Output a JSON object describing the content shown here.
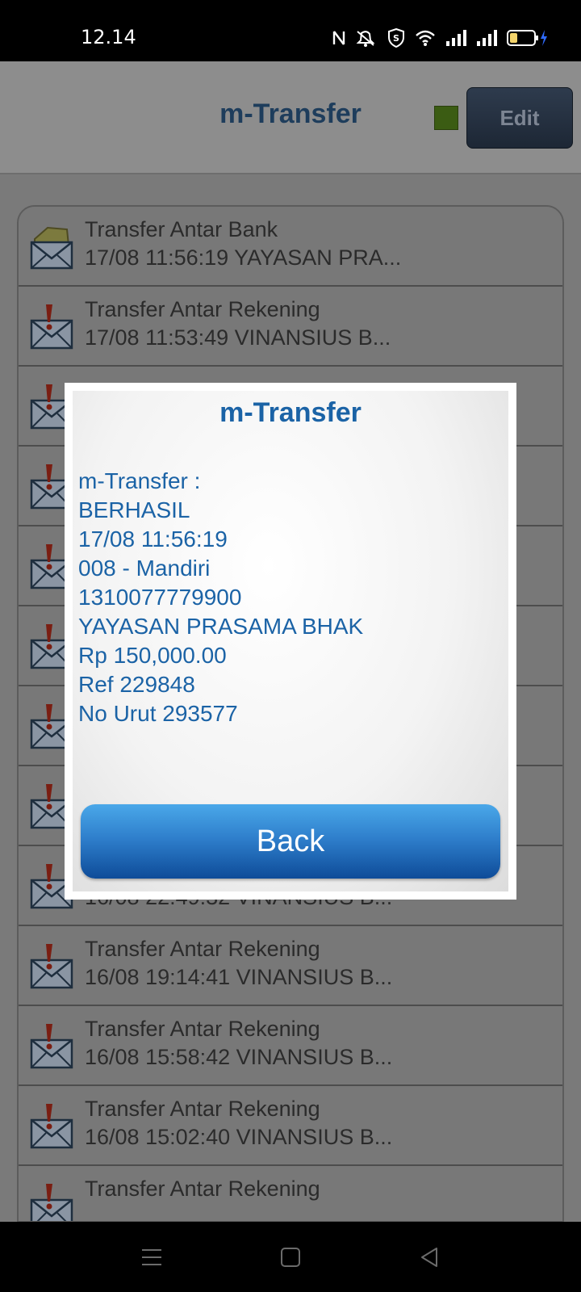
{
  "status_bar": {
    "time": "12.14",
    "icons": [
      "nfc-icon",
      "mute-icon",
      "shield-icon",
      "wifi-icon",
      "signal-icon",
      "signal-icon",
      "battery-charging-icon"
    ]
  },
  "header": {
    "title": "m-Transfer",
    "edit_label": "Edit",
    "status_color": "#3b5c13"
  },
  "list": {
    "items": [
      {
        "title": "Transfer Antar Bank",
        "subtitle": "17/08 11:56:19 YAYASAN PRA...",
        "icon": "open-envelope-icon"
      },
      {
        "title": "Transfer Antar Rekening",
        "subtitle": "17/08 11:53:49 VINANSIUS B...",
        "icon": "unread-envelope-icon"
      },
      {
        "title": "",
        "subtitle": "",
        "icon": "unread-envelope-icon"
      },
      {
        "title": "",
        "subtitle": "",
        "icon": "unread-envelope-icon"
      },
      {
        "title": "",
        "subtitle": "",
        "icon": "unread-envelope-icon"
      },
      {
        "title": "",
        "subtitle": "",
        "icon": "unread-envelope-icon"
      },
      {
        "title": "",
        "subtitle": "",
        "icon": "unread-envelope-icon"
      },
      {
        "title": "",
        "subtitle": "",
        "icon": "unread-envelope-icon"
      },
      {
        "title": "",
        "subtitle": "16/08 22:49:32 VINANSIUS B...",
        "icon": "unread-envelope-icon"
      },
      {
        "title": "Transfer Antar Rekening",
        "subtitle": "16/08 19:14:41 VINANSIUS B...",
        "icon": "unread-envelope-icon"
      },
      {
        "title": "Transfer Antar Rekening",
        "subtitle": "16/08 15:58:42 VINANSIUS B...",
        "icon": "unread-envelope-icon"
      },
      {
        "title": "Transfer Antar Rekening",
        "subtitle": "16/08 15:02:40 VINANSIUS B...",
        "icon": "unread-envelope-icon"
      },
      {
        "title": "Transfer Antar Rekening",
        "subtitle": "",
        "icon": "unread-envelope-icon"
      }
    ]
  },
  "dialog": {
    "title": "m-Transfer",
    "lines": [
      "m-Transfer :",
      "BERHASIL",
      "17/08 11:56:19",
      "008 - Mandiri",
      "1310077779900",
      "YAYASAN PRASAMA BHAK",
      "Rp 150,000.00",
      "Ref 229848",
      "No Urut 293577"
    ],
    "back_label": "Back"
  },
  "nav_bar": {
    "icons": [
      "menu-icon",
      "home-icon",
      "back-icon"
    ]
  },
  "colors": {
    "accent_blue": "#1b63a6",
    "header_title": "#1e3d5c"
  }
}
